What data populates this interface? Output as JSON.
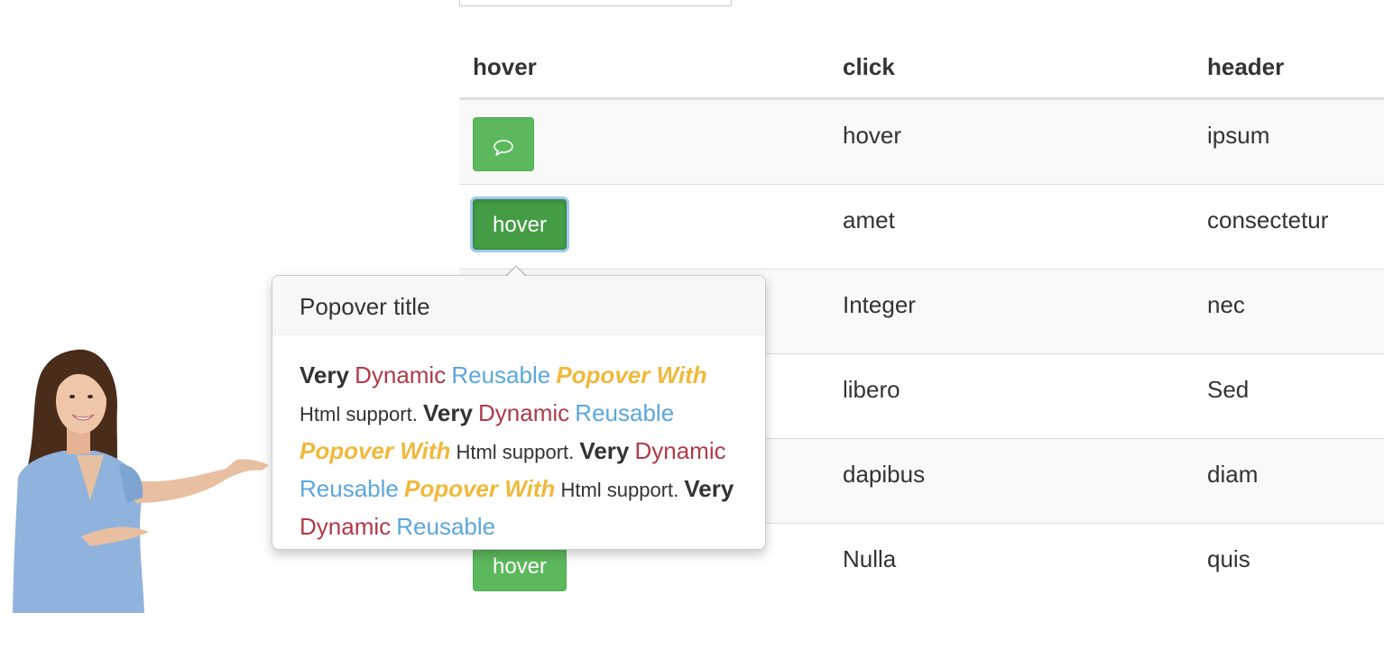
{
  "table": {
    "headers": [
      "hover",
      "click",
      "header"
    ],
    "rows": [
      {
        "button": {
          "type": "icon",
          "icon": "speech-bubble-icon"
        },
        "col2": "hover",
        "col3": "ipsum"
      },
      {
        "button": {
          "type": "text",
          "label": "hover"
        },
        "col2": "amet",
        "col3": "consectetur"
      },
      {
        "button": null,
        "col2": "Integer",
        "col3": "nec"
      },
      {
        "button": null,
        "col2": "libero",
        "col3": "Sed"
      },
      {
        "button": null,
        "col2": "dapibus",
        "col3": "diam"
      },
      {
        "button": {
          "type": "text",
          "label": "hover"
        },
        "col2": "Nulla",
        "col3": "quis"
      }
    ]
  },
  "popover": {
    "title": "Popover title",
    "phrase": {
      "very": "Very",
      "dynamic": "Dynamic",
      "reusable": "Reusable",
      "popover_with": "Popover With",
      "html_support": "Html support."
    }
  },
  "colors": {
    "button_green": "#5cb85c",
    "very": "#333333",
    "dynamic": "#b03a48",
    "reusable": "#5ba7dc",
    "popover_with": "#f0b93b"
  }
}
